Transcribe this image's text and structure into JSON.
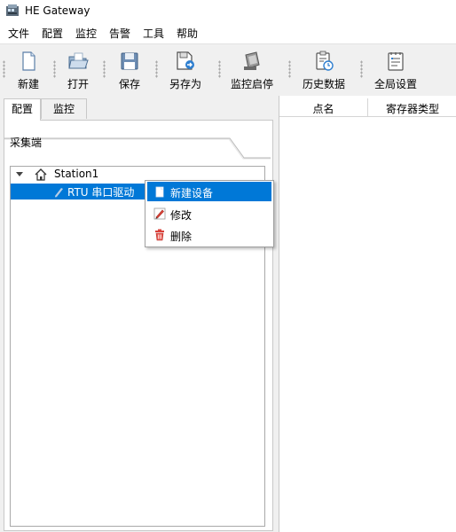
{
  "window": {
    "title": "HE Gateway"
  },
  "menubar": {
    "items": [
      "文件",
      "配置",
      "监控",
      "告警",
      "工具",
      "帮助"
    ]
  },
  "toolbar": {
    "buttons": [
      {
        "label": "新建",
        "icon": "new-file-icon"
      },
      {
        "label": "打开",
        "icon": "open-folder-icon"
      },
      {
        "label": "保存",
        "icon": "save-disk-icon"
      },
      {
        "label": "另存为",
        "icon": "save-as-icon"
      },
      {
        "label": "监控启停",
        "icon": "monitor-start-stop-icon"
      },
      {
        "label": "历史数据",
        "icon": "history-data-icon"
      },
      {
        "label": "全局设置",
        "icon": "global-settings-icon"
      }
    ]
  },
  "left_panel": {
    "tabs": [
      {
        "label": "配置",
        "active": true
      },
      {
        "label": "监控",
        "active": false
      }
    ],
    "section_title": "采集端",
    "tree": {
      "root": {
        "label": "Station1",
        "icon": "home-icon",
        "expanded": true
      },
      "child": {
        "label": "RTU 串口驱动",
        "icon": "pen-icon",
        "selected": true
      }
    }
  },
  "right_panel": {
    "columns": [
      "点名",
      "寄存器类型"
    ]
  },
  "context_menu": {
    "items": [
      {
        "label": "新建设备",
        "icon": "new-device-icon",
        "highlighted": true
      },
      {
        "label": "修改",
        "icon": "edit-pencil-icon",
        "highlighted": false
      },
      {
        "label": "删除",
        "icon": "delete-trash-icon",
        "highlighted": false
      }
    ]
  },
  "colors": {
    "selection": "#0078d7",
    "toolbar_bg": "#f0f0f0",
    "delete_red": "#d9413a"
  }
}
